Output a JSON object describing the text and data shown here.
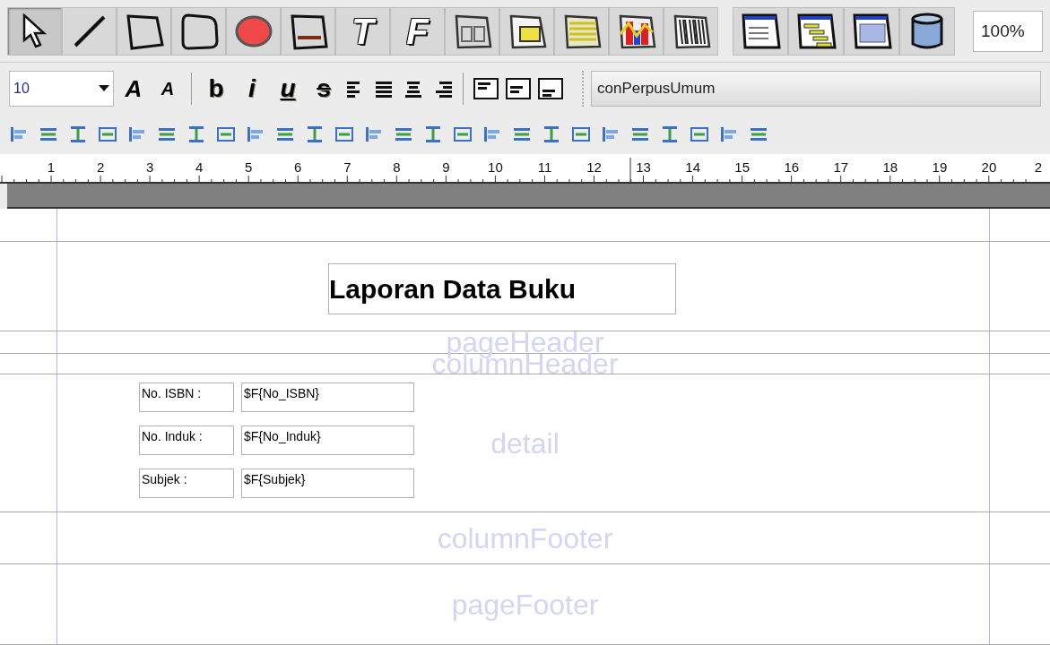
{
  "tools": [
    {
      "kind": "pointer",
      "selected": true
    },
    {
      "kind": "line",
      "selected": false
    },
    {
      "kind": "rect",
      "selected": false
    },
    {
      "kind": "roundrect",
      "selected": false
    },
    {
      "kind": "ellipse",
      "selected": false
    },
    {
      "kind": "image",
      "selected": false
    },
    {
      "kind": "letter",
      "label": "T",
      "selected": false
    },
    {
      "kind": "letter",
      "label": "F",
      "selected": false
    },
    {
      "kind": "frame",
      "selected": false
    },
    {
      "kind": "subreport",
      "selected": false
    },
    {
      "kind": "crosstab",
      "selected": false
    },
    {
      "kind": "chart",
      "selected": false
    },
    {
      "kind": "barcode",
      "selected": false
    }
  ],
  "views": [
    {
      "kind": "report"
    },
    {
      "kind": "group"
    },
    {
      "kind": "band"
    },
    {
      "kind": "database"
    }
  ],
  "zoom": "100%",
  "font_size": "10",
  "font_buttons": [
    {
      "label": "A",
      "kind": "grow"
    },
    {
      "label": "A",
      "kind": "shrink"
    }
  ],
  "style_buttons": [
    {
      "label": "b",
      "kind": "bold"
    },
    {
      "label": "i",
      "kind": "italic"
    },
    {
      "label": "u",
      "kind": "underline"
    },
    {
      "label": "s",
      "kind": "strike"
    }
  ],
  "connection": "conPerpusUmum",
  "ruler": [
    "1",
    "2",
    "3",
    "4",
    "5",
    "6",
    "7",
    "8",
    "9",
    "10",
    "11",
    "12",
    "13",
    "14",
    "15",
    "16",
    "17",
    "18",
    "19",
    "20",
    "2"
  ],
  "bands": [
    {
      "kind": "background"
    },
    {
      "kind": "title",
      "text": "Laporan Data Buku"
    },
    {
      "kind": "plain",
      "label": "pageHeader"
    },
    {
      "kind": "plain",
      "label": "columnHeader"
    },
    {
      "kind": "detail",
      "label": "detail",
      "rows": [
        {
          "label": "No. ISBN :",
          "field": "$F{No_ISBN}"
        },
        {
          "label": "No. Induk :",
          "field": "$F{No_Induk}"
        },
        {
          "label": "Subjek :",
          "field": "$F{Subjek}"
        }
      ]
    },
    {
      "kind": "plain",
      "label": "columnFooter"
    },
    {
      "kind": "plain",
      "label": "pageFooter"
    }
  ]
}
